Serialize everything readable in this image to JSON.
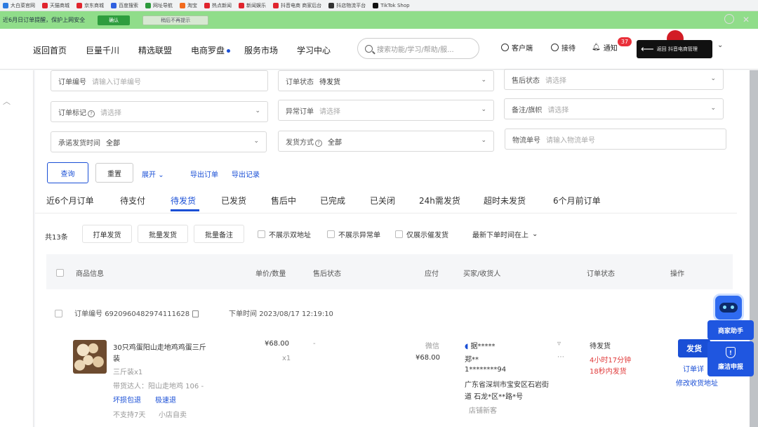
{
  "browser": {
    "bookmarks": [
      {
        "label": "大白菜官网",
        "color": "#2d7be0"
      },
      {
        "label": "天猫商城",
        "color": "#e0252e"
      },
      {
        "label": "京东商城",
        "color": "#e0252e"
      },
      {
        "label": "百度搜索",
        "color": "#3060e0"
      },
      {
        "label": "网址导航",
        "color": "#2d9a3c"
      },
      {
        "label": "淘宝",
        "color": "#f26b1d"
      },
      {
        "label": "热点新闻",
        "color": "#e0252e"
      },
      {
        "label": "新闻娱乐",
        "color": "#e0252e"
      },
      {
        "label": "抖音电商 商家后台",
        "color": "#e0252e"
      },
      {
        "label": "抖店物流平台",
        "color": "#333333"
      },
      {
        "label": "TikTok Shop",
        "color": "#111111"
      }
    ]
  },
  "notice": {
    "text": "近6月日订单提醒，保护上网安全",
    "ok_label": "确认",
    "later_label": "稍后不再提示"
  },
  "nav": {
    "items": [
      "返回首页",
      "巨量千川",
      "精选联盟",
      "电商罗盘",
      "服务市场",
      "学习中心"
    ],
    "search_placeholder": "搜索功能/学习/帮助/服...",
    "customer_service": "客户端",
    "receive": "接待",
    "notify": "通知",
    "notify_count": "37",
    "back_label": "返回 抖音电商管理",
    "accent": "#1a4fd6"
  },
  "filters": {
    "order_no": {
      "label": "订单编号",
      "placeholder": "请输入订单编号"
    },
    "order_status": {
      "label": "订单状态",
      "value": "待发货"
    },
    "after_sale": {
      "label": "售后状态",
      "placeholder": "请选择"
    },
    "order_mark": {
      "label": "订单标记",
      "placeholder": "请选择"
    },
    "abnormal": {
      "label": "异常订单",
      "placeholder": "请选择"
    },
    "remark": {
      "label": "备注/旗帜",
      "placeholder": "请选择"
    },
    "promise_time": {
      "label": "承诺发货时间",
      "value": "全部"
    },
    "ship_method": {
      "label": "发货方式",
      "value": "全部"
    },
    "logistics_no": {
      "label": "物流单号",
      "placeholder": "请输入物流单号"
    },
    "query_label": "查询",
    "reset_label": "重置",
    "expand_label": "展开",
    "export_label": "导出订单",
    "export_record_label": "导出记录"
  },
  "tabs": [
    "近6个月订单",
    "待支付",
    "待发货",
    "已发货",
    "售后中",
    "已完成",
    "已关闭",
    "24h需发货",
    "超时未发货",
    "6个月前订单"
  ],
  "toolbar": {
    "count": "共13条",
    "print_ship": "打单发货",
    "batch_ship": "批量发货",
    "batch_remark": "批量备注",
    "opt_double_addr": "不展示双地址",
    "opt_abnormal": "不展示异常单",
    "opt_reminder": "仅展示催发货",
    "sort": "最新下单时间在上"
  },
  "table": {
    "headers": [
      "商品信息",
      "单价/数量",
      "售后状态",
      "应付",
      "买家/收货人",
      "订单状态",
      "操作"
    ]
  },
  "order": {
    "order_no_label": "订单编号",
    "order_no": "6920960482974111628",
    "time_label": "下单时间",
    "time": "2023/08/17 12:19:10",
    "product_title_1": "30只鸡蛋阳山走地鸡鸡蛋三斤",
    "product_title_2": "装",
    "spec": "三斤装x1",
    "influencer": "带货达人：阳山走地鸡 106 -",
    "tag_return": "坏损包退",
    "tag_refund": "极速退",
    "no_return": "不支持7天",
    "insurance": "小店自卖",
    "price": "¥68.00",
    "qty": "x1",
    "after_sale": "-",
    "pay_method": "微信",
    "pay_amount": "¥68.00",
    "buyer": "据*****",
    "receiver": "郑**",
    "phone": "1********94",
    "address_1": "广东省深圳市宝安区石岩街",
    "address_2": "道 石龙*区**路*号",
    "shop_label": "店铺新客",
    "status": "待发货",
    "countdown_1": "4小时17分钟",
    "countdown_2": "18秒内发货",
    "ship_label": "发货",
    "detail_label": "订单详",
    "modify_addr": "修改收货地址"
  },
  "helper": {
    "assist_label": "商家助手",
    "report_label": "廉洁申报"
  }
}
